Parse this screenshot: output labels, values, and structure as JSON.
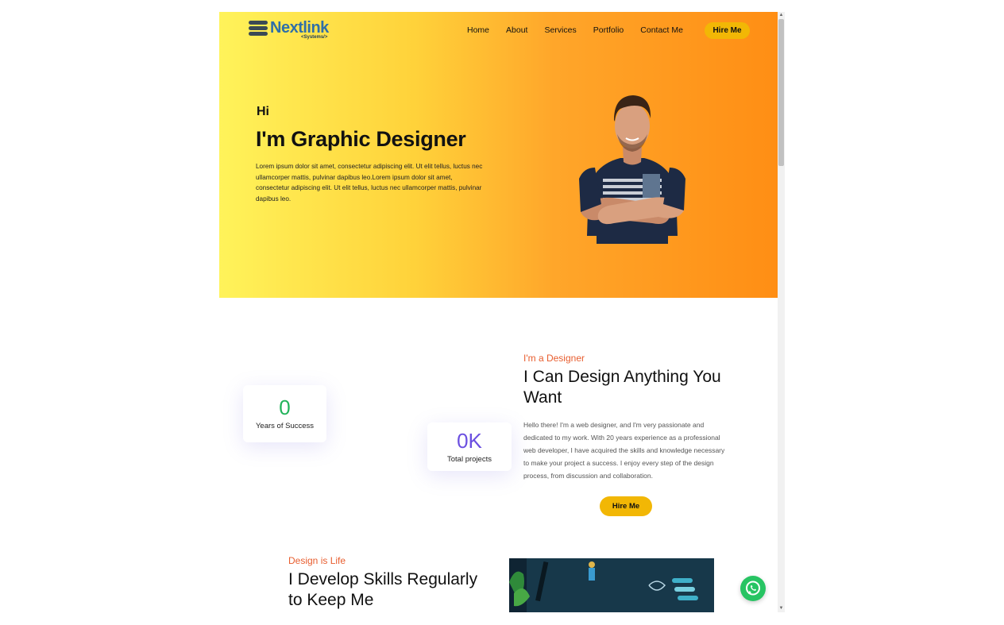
{
  "brand": {
    "name": "Nextlink",
    "tagline": "<Systems/>"
  },
  "nav": {
    "items": [
      "Home",
      "About",
      "Services",
      "Portfolio",
      "Contact Me"
    ],
    "cta": "Hire Me"
  },
  "hero": {
    "greeting": "Hi",
    "title": "I'm Graphic Designer",
    "text": "Lorem ipsum dolor sit amet, consectetur adipiscing elit. Ut elit tellus, luctus nec ullamcorper mattis, pulvinar dapibus leo.Lorem ipsum dolor sit amet, consectetur adipiscing elit. Ut elit tellus, luctus nec ullamcorper mattis, pulvinar dapibus leo."
  },
  "stats": [
    {
      "value": "0",
      "label": "Years of Success",
      "color": "#22b35a"
    },
    {
      "value": "0K",
      "label": "Total projects",
      "color": "#6b4fe0"
    }
  ],
  "about": {
    "kicker": "I'm a Designer",
    "title": "I Can Design Anything You Want",
    "text": " Hello there! I'm a web designer, and I'm very passionate and dedicated to my work. With 20 years experience as a professional web developer, I have acquired the skills and knowledge necessary to make your project a success. I enjoy every step of the design process, from discussion and collaboration.",
    "cta": "Hire Me"
  },
  "skills": {
    "kicker": "Design is Life",
    "title": "I Develop Skills Regularly to Keep Me"
  },
  "colors": {
    "accent": "#f2b705",
    "kicker": "#e85d2e",
    "whatsapp": "#27c463"
  }
}
